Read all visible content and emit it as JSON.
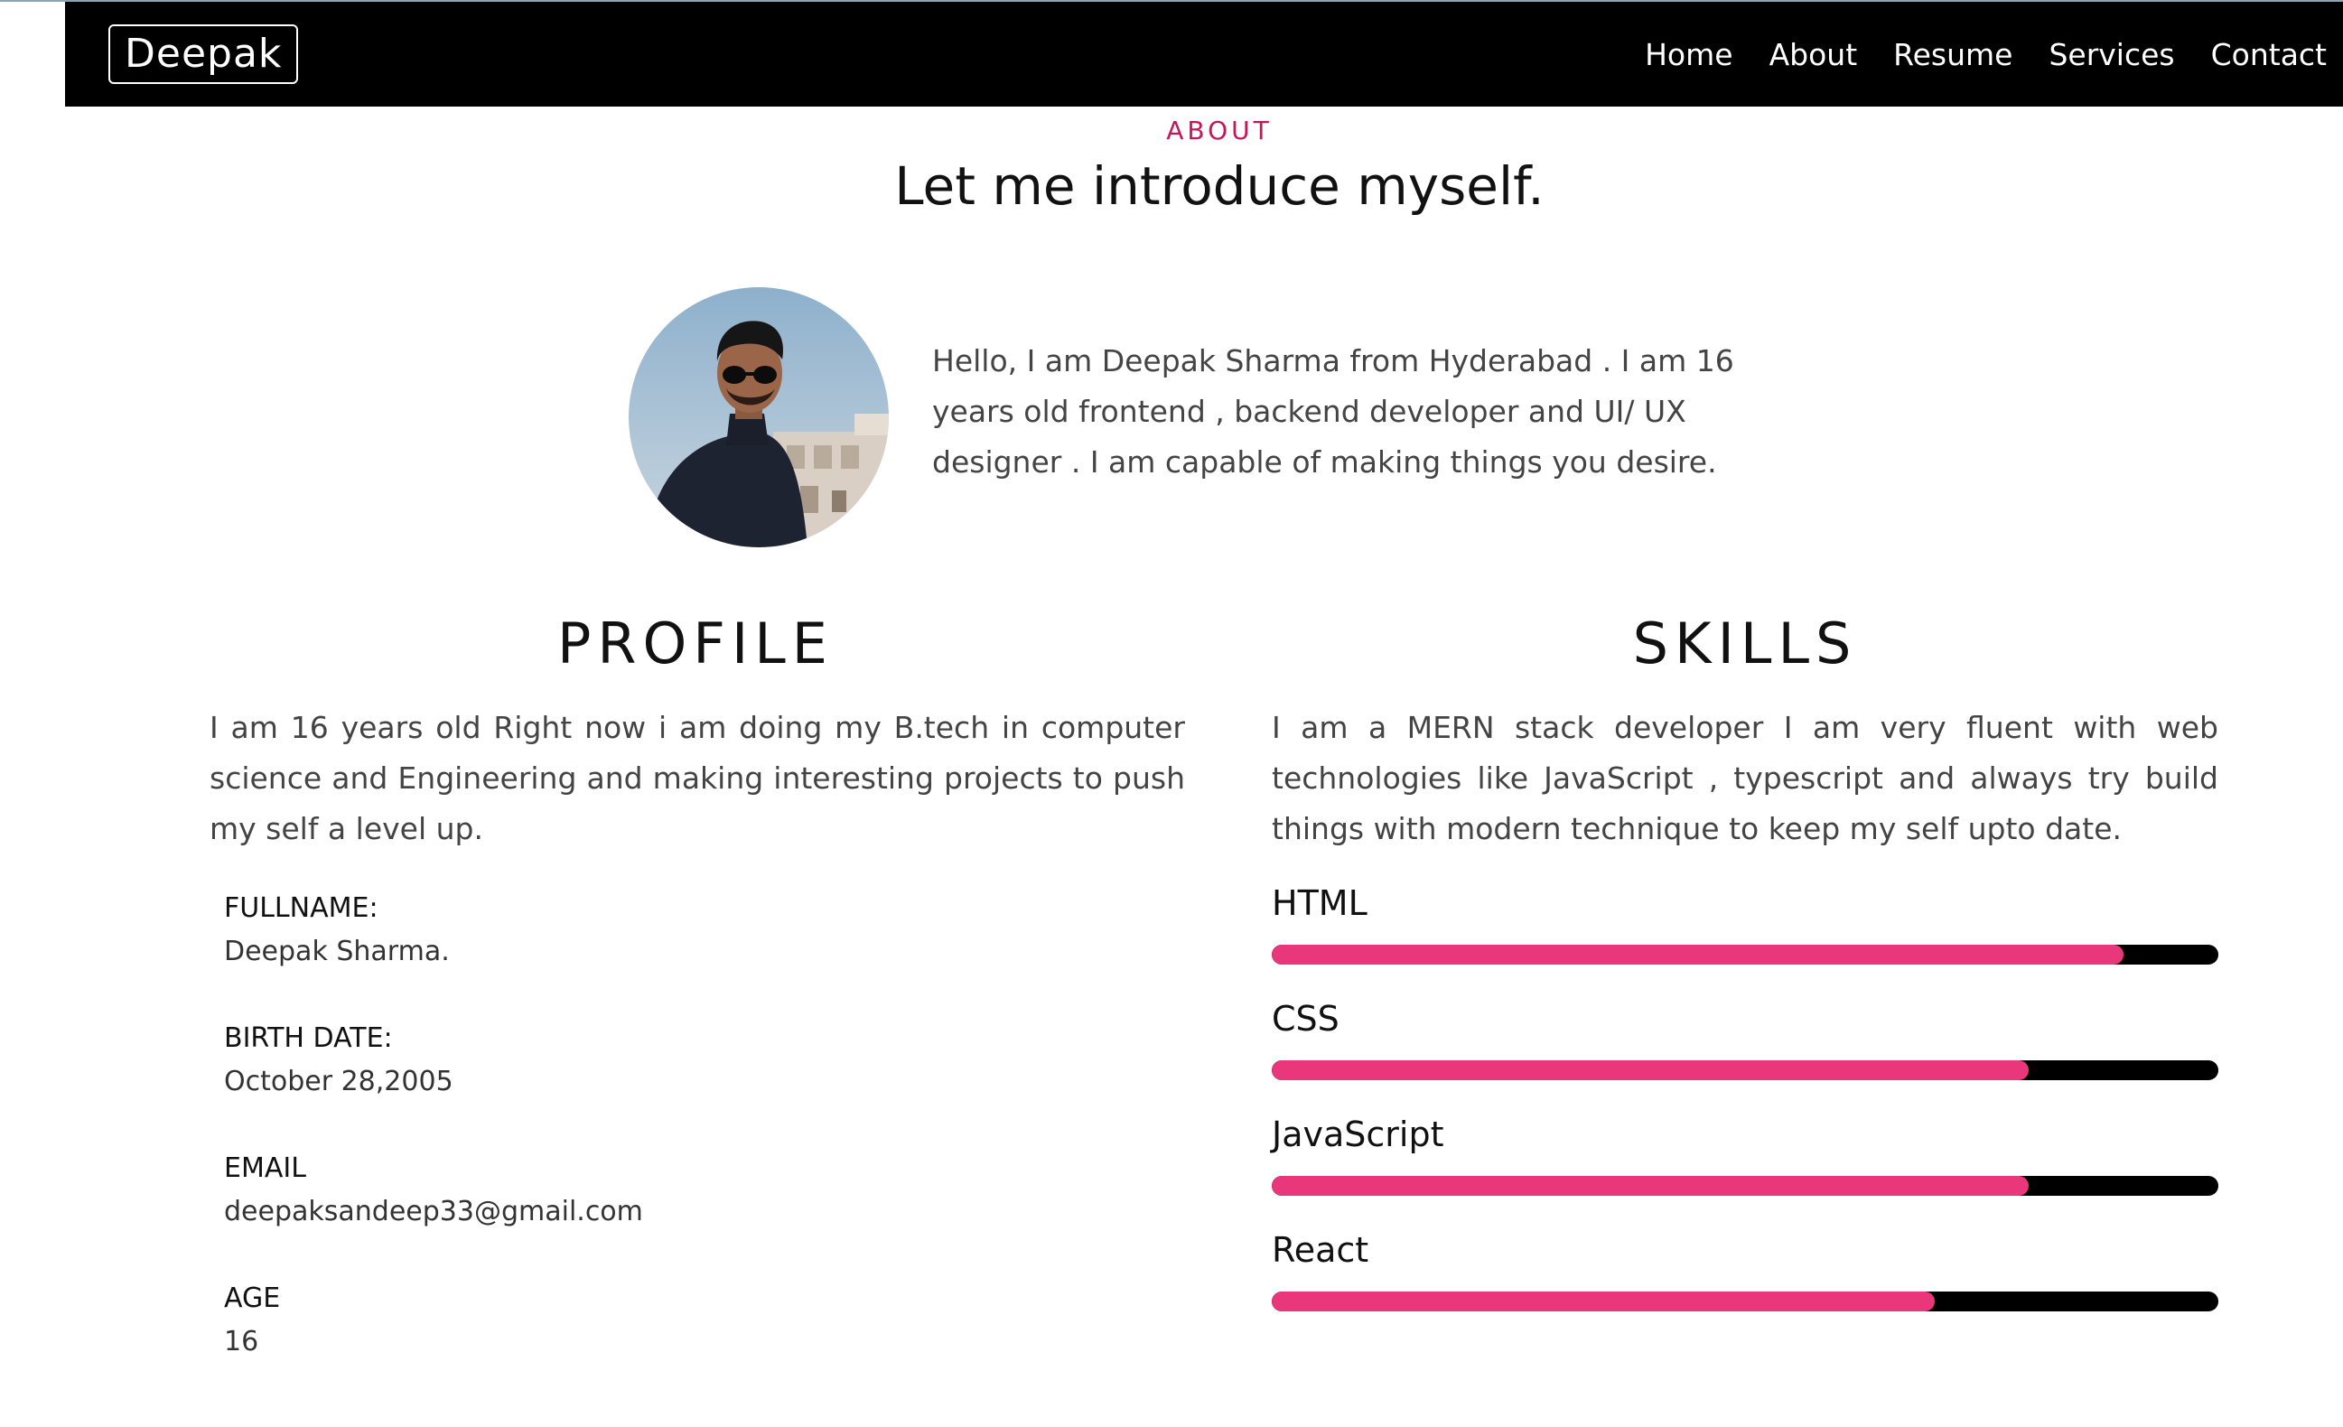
{
  "navbar": {
    "brand": "Deepak",
    "links": [
      "Home",
      "About",
      "Resume",
      "Services",
      "Contact"
    ]
  },
  "about": {
    "eyebrow": "ABOUT",
    "headline": "Let me introduce myself.",
    "intro": "Hello, I am Deepak Sharma from Hyderabad . I am 16 years old frontend , backend developer and UI/ UX designer . I am capable of making things you desire."
  },
  "profile": {
    "title": "PROFILE",
    "text": "I am 16 years old Right now i am doing my B.tech in computer science and Engineering and making interesting projects to push my self a level up.",
    "fields": [
      {
        "label": "FULLNAME:",
        "value": "Deepak Sharma."
      },
      {
        "label": "BIRTH DATE:",
        "value": "October 28,2005"
      },
      {
        "label": "EMAIL",
        "value": "deepaksandeep33@gmail.com"
      },
      {
        "label": "AGE",
        "value": "16"
      }
    ]
  },
  "skills": {
    "title": "SKILLS",
    "text": "I am a MERN stack developer I am very fluent with web technologies like JavaScript , typescript and always try build things with modern technique to keep my self upto date.",
    "items": [
      {
        "name": "HTML",
        "level": 0.9
      },
      {
        "name": "CSS",
        "level": 0.8
      },
      {
        "name": "JavaScript",
        "level": 0.8
      },
      {
        "name": "React",
        "level": 0.7
      }
    ]
  },
  "colors": {
    "accent": "#ea367a",
    "eyebrow": "#c2185b",
    "navbar_bg": "#000000",
    "bar_track": "#000000"
  }
}
